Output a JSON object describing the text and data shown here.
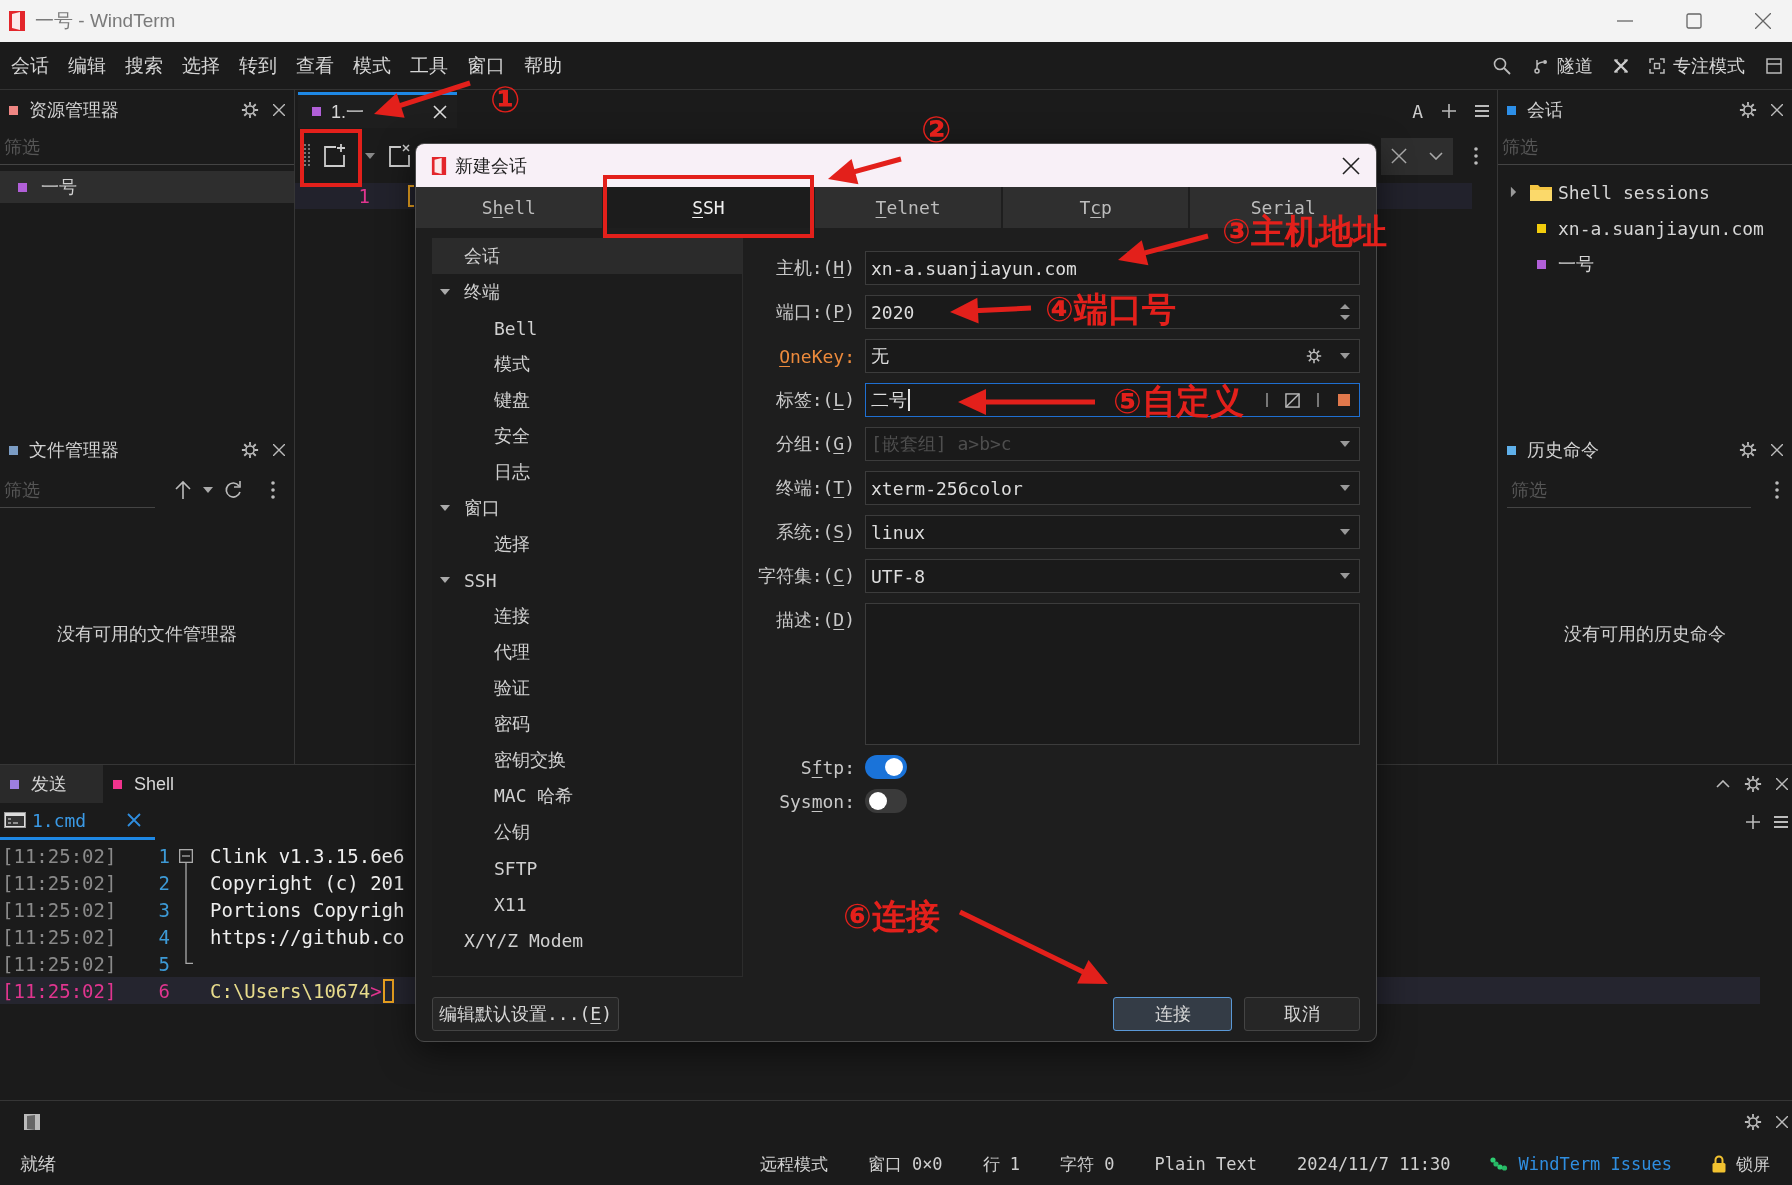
{
  "window": {
    "title": "一号 - WindTerm"
  },
  "menu": [
    "会话",
    "编辑",
    "搜索",
    "选择",
    "转到",
    "查看",
    "模式",
    "工具",
    "窗口",
    "帮助"
  ],
  "toolbar": {
    "tunnel": "隧道",
    "focus_mode": "专注模式"
  },
  "explorer": {
    "title": "资源管理器",
    "filter_placeholder": "筛选",
    "items": [
      {
        "label": "一号",
        "color": "#b15fd8",
        "selected": true
      }
    ]
  },
  "file_manager": {
    "title": "文件管理器",
    "filter_placeholder": "筛选",
    "empty_text": "没有可用的文件管理器"
  },
  "editor": {
    "tabs": [
      {
        "label": "1.一",
        "color": "#b15fd8",
        "selected": true
      }
    ],
    "font_button": "A",
    "lines": [
      {
        "number": "1",
        "current": true
      }
    ]
  },
  "sessions": {
    "title": "会话",
    "filter_placeholder": "筛选",
    "items": [
      {
        "kind": "folder",
        "label": "Shell sessions",
        "expanded": false,
        "selected": false
      },
      {
        "kind": "session",
        "label": "xn-a.suanjiayun.com",
        "color": "#f2cc0c",
        "selected": false
      },
      {
        "kind": "session",
        "label": "一号",
        "color": "#b15fd8",
        "selected": false
      }
    ]
  },
  "history": {
    "title": "历史命令",
    "filter_placeholder": "筛选",
    "empty_text": "没有可用的历史命令"
  },
  "bottom_panel": {
    "tabs": [
      {
        "label": "发送",
        "color": "#9d7fe0",
        "selected": true
      },
      {
        "label": "Shell",
        "color": "#f0338d",
        "selected": false
      }
    ],
    "terminal_tabs": [
      {
        "label": "1.cmd",
        "selected": true
      }
    ],
    "lines": [
      {
        "time": "[11:25:02]",
        "number": "1",
        "kind": "output",
        "fold_expanded": true,
        "in_fold": false,
        "text": "Clink v1.3.15.6e6",
        "current": false
      },
      {
        "time": "[11:25:02]",
        "number": "2",
        "kind": "output",
        "in_fold": true,
        "text": "Copyright (c) 201",
        "current": false
      },
      {
        "time": "[11:25:02]",
        "number": "3",
        "kind": "output",
        "in_fold": true,
        "text": "Portions Copyrigh",
        "current": false
      },
      {
        "time": "[11:25:02]",
        "number": "4",
        "kind": "output",
        "in_fold": true,
        "text": "https://github.co",
        "current": false
      },
      {
        "time": "[11:25:02]",
        "number": "5",
        "in_fold": true,
        "current": false
      },
      {
        "time": "[11:25:02]",
        "number": "6",
        "kind": "prompt",
        "in_fold": false,
        "text": "C:\\Users\\10674",
        "mark": ">",
        "current": true
      }
    ]
  },
  "status_bar": {
    "message": "就绪",
    "items": [
      {
        "kind": "text",
        "label": "远程模式"
      },
      {
        "kind": "text",
        "label": "窗口 0×0"
      },
      {
        "kind": "text",
        "label": "行 1"
      },
      {
        "kind": "text",
        "label": "字符 0"
      },
      {
        "kind": "text",
        "label": "Plain Text"
      },
      {
        "kind": "text",
        "label": "2024/11/7 11:30"
      },
      {
        "kind": "link",
        "label": "WindTerm Issues"
      },
      {
        "kind": "lock",
        "label": "锁屏"
      }
    ]
  },
  "dialog": {
    "title": "新建会话",
    "tabs": [
      {
        "label": {
          "pre": "S",
          "key": "h",
          "post": "ell"
        },
        "selected": false
      },
      {
        "label": {
          "key": "S",
          "post": "SH"
        },
        "selected": true
      },
      {
        "label": {
          "key": "T",
          "post": "elnet"
        },
        "selected": false
      },
      {
        "label": {
          "pre": "T",
          "key": "c",
          "post": "p"
        },
        "selected": false
      },
      {
        "label": "Serial",
        "selected": false
      }
    ],
    "nav": [
      {
        "label": "会话",
        "selected": true
      },
      {
        "label": "终端",
        "expanded": true,
        "selected": false,
        "children": [
          {
            "label": "Bell",
            "selected": false
          },
          {
            "label": "模式",
            "selected": false
          },
          {
            "label": "键盘",
            "selected": false
          },
          {
            "label": "安全",
            "selected": false
          },
          {
            "label": "日志",
            "selected": false
          }
        ]
      },
      {
        "label": "窗口",
        "expanded": true,
        "selected": false,
        "children": [
          {
            "label": "选择",
            "selected": false
          }
        ]
      },
      {
        "label": "SSH",
        "expanded": true,
        "selected": false,
        "children": [
          {
            "label": "连接",
            "selected": false
          },
          {
            "label": "代理",
            "selected": false
          },
          {
            "label": "验证",
            "selected": false
          },
          {
            "label": "密码",
            "selected": false
          },
          {
            "label": "密钥交换",
            "selected": false
          },
          {
            "label": "MAC 哈希",
            "selected": false
          },
          {
            "label": "公钥",
            "selected": false
          },
          {
            "label": "SFTP",
            "selected": false
          },
          {
            "label": "X11",
            "selected": false
          }
        ]
      },
      {
        "label": "X/Y/Z Modem",
        "selected": false
      }
    ],
    "fields": [
      {
        "kind": "text",
        "label": {
          "pre": "主机:(",
          "key": "H",
          "post": ")"
        },
        "value": "xn-a.suanjiayun.com",
        "focused": false,
        "emphasized": false
      },
      {
        "kind": "spin",
        "label": {
          "pre": "端口:(",
          "key": "P",
          "post": ")"
        },
        "value": "2020",
        "focused": false,
        "emphasized": false
      },
      {
        "kind": "combo-gear",
        "label": {
          "key": "O",
          "post": "neKey:"
        },
        "value": "无",
        "focused": false,
        "emphasized": true
      },
      {
        "kind": "tag",
        "label": {
          "pre": "标签:(",
          "key": "L",
          "post": ")"
        },
        "value": "二号",
        "color": "#e0784c",
        "focused": true,
        "emphasized": false
      },
      {
        "kind": "combo",
        "label": {
          "pre": "分组:(",
          "key": "G",
          "post": ")"
        },
        "placeholder": "[嵌套组] a>b>c",
        "focused": false,
        "emphasized": false
      },
      {
        "kind": "combo",
        "label": {
          "pre": "终端:(",
          "key": "T",
          "post": ")"
        },
        "value": "xterm-256color",
        "focused": false,
        "emphasized": false
      },
      {
        "kind": "combo",
        "label": {
          "pre": "系统:(",
          "key": "S",
          "post": ")"
        },
        "value": "linux",
        "focused": false,
        "emphasized": false
      },
      {
        "kind": "combo",
        "label": {
          "pre": "字符集:(",
          "key": "C",
          "post": ")"
        },
        "value": "UTF-8",
        "focused": false,
        "emphasized": false
      },
      {
        "kind": "textarea",
        "label": {
          "pre": "描述:(",
          "key": "D",
          "post": ")"
        },
        "focused": false,
        "emphasized": false
      }
    ],
    "switches": [
      {
        "label": {
          "pre": "S",
          "key": "f",
          "post": "tp:"
        },
        "on": true
      },
      {
        "label": {
          "pre": "Sys",
          "key": "m",
          "post": "on:"
        },
        "on": false
      }
    ],
    "buttons": [
      {
        "kind": "plain",
        "label": {
          "pre": "编辑默认设置...(",
          "key": "E",
          "post": ")"
        }
      },
      {
        "kind": "primary",
        "label": "连接"
      },
      {
        "kind": "plain",
        "label": "取消"
      }
    ]
  },
  "annotations": [
    "①",
    "②",
    "③主机地址",
    "④端口号",
    "⑤自定义",
    "⑥连接"
  ]
}
